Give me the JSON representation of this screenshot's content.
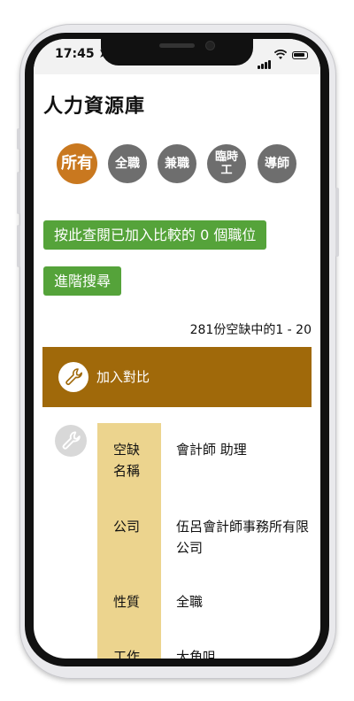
{
  "status": {
    "time": "17:45 ➤"
  },
  "page": {
    "title": "人力資源庫"
  },
  "categories": [
    {
      "label": "所有",
      "active": true
    },
    {
      "label": "全職",
      "active": false
    },
    {
      "label": "兼職",
      "active": false
    },
    {
      "label": "臨時工",
      "active": false
    },
    {
      "label": "導師",
      "active": false
    }
  ],
  "buttons": {
    "compare_view": "按此查閱已加入比較的 0 個職位",
    "advanced_search": "進階搜尋"
  },
  "results": {
    "count_text": "281份空缺中的1 - 20"
  },
  "compare_bar": {
    "label": "加入對比"
  },
  "job": {
    "rows": [
      {
        "label": "空缺名稱",
        "value": "會計師 助理"
      },
      {
        "label": "公司",
        "value": "伍呂會計師事務所有限公司"
      },
      {
        "label": "性質",
        "value": "全職"
      },
      {
        "label": "工作",
        "value": "大角咀"
      }
    ]
  },
  "colors": {
    "accent_orange": "#c9781f",
    "green": "#55a33a",
    "compare_brown": "#a0690a",
    "label_yellow": "#ecd48e"
  }
}
